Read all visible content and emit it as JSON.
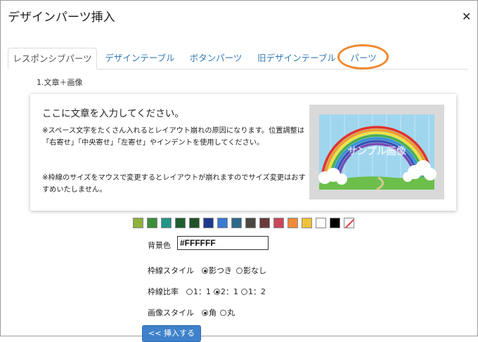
{
  "dialog": {
    "title": "デザインパーツ挿入"
  },
  "tabs": [
    {
      "label": "レスポンシブパーツ",
      "active": true
    },
    {
      "label": "デザインテーブル",
      "active": false
    },
    {
      "label": "ボタンパーツ",
      "active": false
    },
    {
      "label": "旧デザインテーブル",
      "active": false
    },
    {
      "label": "パーツ",
      "active": false
    }
  ],
  "section_label": "1.文章＋画像",
  "card": {
    "heading": "ここに文章を入力してください。",
    "paragraph1": "※スペース文字をたくさん入れるとレイアウト崩れの原因になります。位置調整は「右寄せ」「中央寄せ」「左寄せ」やインデントを使用してください。",
    "paragraph2": "※枠線のサイズをマウスで変更するとレイアウトが崩れますのでサイズ変更はおすすめいたしません。",
    "image_text": "サンプル画像"
  },
  "swatches": [
    "#8db23b",
    "#3a8f3a",
    "#239488",
    "#1f5e2e",
    "#225229",
    "#1c3a8c",
    "#3a7ad0",
    "#2f6a8a",
    "#4a4840",
    "#6b3a3a",
    "#c8485a",
    "#ef8a3a",
    "#f0c23a",
    "#ffffff",
    "#000000",
    "none"
  ],
  "background": {
    "label": "背景色",
    "value": "#FFFFFF"
  },
  "border_style": {
    "label": "枠線スタイル",
    "options": [
      "影つき",
      "影なし"
    ],
    "selected": 0
  },
  "border_ratio": {
    "label": "枠線比率",
    "options": [
      "1：1",
      "2：1",
      "1：2"
    ],
    "selected": 1
  },
  "image_style": {
    "label": "画像スタイル",
    "options": [
      "角",
      "丸"
    ],
    "selected": 0
  },
  "insert_button": "<< 挿入する"
}
